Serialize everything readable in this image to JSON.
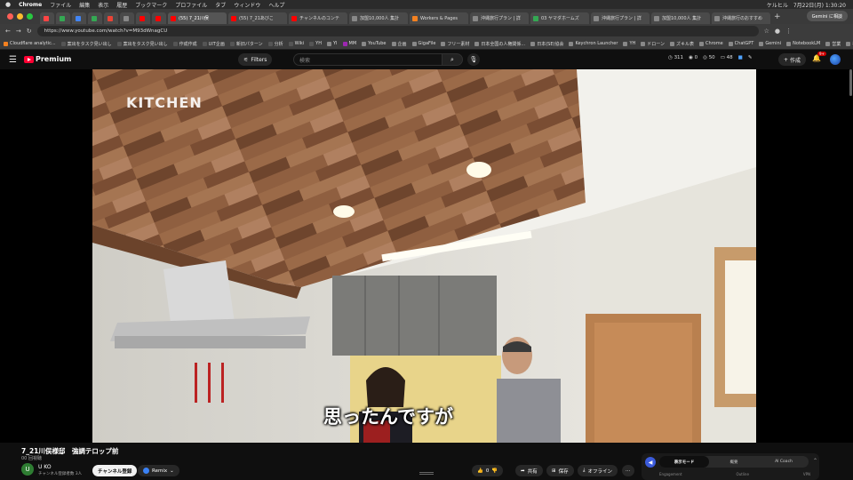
{
  "menubar": {
    "app": "Chrome",
    "items": [
      "ファイル",
      "編集",
      "表示",
      "履歴",
      "ブックマーク",
      "プロファイル",
      "タブ",
      "ウィンドウ",
      "ヘルプ"
    ],
    "right": {
      "user": "ケルヒル",
      "datetime": "7月22日(月) 1:30:20"
    }
  },
  "tabs": [
    {
      "kind": "mini",
      "color": "#ff4444"
    },
    {
      "kind": "mini",
      "color": "#34a853"
    },
    {
      "kind": "mini",
      "color": "#4285f4"
    },
    {
      "kind": "mini",
      "color": "#34a853"
    },
    {
      "kind": "mini",
      "color": "#ea4335"
    },
    {
      "kind": "mini",
      "color": "#888888"
    },
    {
      "kind": "mini",
      "color": "#ff0000"
    },
    {
      "kind": "mini",
      "color": "#ff0000"
    },
    {
      "kind": "wide",
      "label": "(55) 7_21川俣",
      "color": "#ff0000",
      "active": true
    },
    {
      "kind": "wide",
      "label": "(55) 7_21あびこ",
      "color": "#ff0000"
    },
    {
      "kind": "wide",
      "label": "チャンネルのコンテ",
      "color": "#ff0000"
    },
    {
      "kind": "wide",
      "label": "加盟10,000人 集計",
      "color": "#888888"
    },
    {
      "kind": "wide",
      "label": "Workers & Pages",
      "color": "#f48120"
    },
    {
      "kind": "wide",
      "label": "沖縄旅行プラン | 詳",
      "color": "#888888"
    },
    {
      "kind": "wide",
      "label": "03 ヤマダホームズ",
      "color": "#34a853"
    },
    {
      "kind": "wide",
      "label": "沖縄旅行プラン | 詳",
      "color": "#888888"
    },
    {
      "kind": "wide",
      "label": "加盟10,000人 集計",
      "color": "#888888"
    },
    {
      "kind": "wide",
      "label": "沖縄旅行のおすすめ",
      "color": "#888888"
    }
  ],
  "gemini_label": "Gemini に相談",
  "url": "https://www.youtube.com/watch?v=M93dWnagCU",
  "bookmarks": [
    {
      "label": "Cloudflare analytic...",
      "color": "#f48120"
    },
    {
      "label": "案出をタスク見い出し",
      "color": "#555555"
    },
    {
      "label": "案出をタスク見い出し",
      "color": "#555555"
    },
    {
      "label": "作成作成",
      "color": "#555555"
    },
    {
      "label": "UIT企画",
      "color": "#555555"
    },
    {
      "label": "新旧パターン",
      "color": "#555555"
    },
    {
      "label": "分析",
      "color": "#555555"
    },
    {
      "label": "Wiki",
      "color": "#555555"
    },
    {
      "label": "YH",
      "color": "#555555"
    },
    {
      "label": "YI",
      "color": "#888888"
    },
    {
      "label": "MM",
      "color": "#9c27b0"
    },
    {
      "label": "YouTube",
      "color": "#888888"
    },
    {
      "label": "企画",
      "color": "#888888"
    },
    {
      "label": "GigaFile",
      "color": "#888888"
    },
    {
      "label": "フリー素材",
      "color": "#888888"
    },
    {
      "label": "日本全国の人権関係...",
      "color": "#888888"
    },
    {
      "label": "日本(SE)協会",
      "color": "#888888"
    },
    {
      "label": "Keychron Launcher",
      "color": "#888888"
    },
    {
      "label": "YH",
      "color": "#888888"
    },
    {
      "label": "ドローン",
      "color": "#888888"
    },
    {
      "label": "ズキル表",
      "color": "#888888"
    },
    {
      "label": "Chrome",
      "color": "#888888"
    },
    {
      "label": "ChatGPT",
      "color": "#888888"
    },
    {
      "label": "Gemini",
      "color": "#888888"
    },
    {
      "label": "NotebookLM",
      "color": "#888888"
    },
    {
      "label": "営業",
      "color": "#888888"
    },
    {
      "label": "補助金",
      "color": "#888888"
    },
    {
      "label": "便利サイト",
      "color": "#888888"
    }
  ],
  "yt": {
    "brand": "Premium",
    "filters": "Filters",
    "search_placeholder": "検索",
    "stats": [
      "311",
      "0",
      "50",
      "48"
    ],
    "create": "作成",
    "notif": "9+"
  },
  "video": {
    "overlay": "KITCHEN",
    "caption": "思ったんですが"
  },
  "info": {
    "title": "7_21川俣様邸　強調テロップ前",
    "views": "00 回視聴",
    "channel": "U KO",
    "subs": "チャンネル登録者数 3人",
    "subscribe": "チャンネル登録",
    "remix": "Remix",
    "likes": "0",
    "share": "共有",
    "save": "保存",
    "offline": "オフライン"
  },
  "sidepanel": {
    "segments": [
      "表示モード",
      "概要",
      "AI Coach"
    ],
    "active": 0,
    "labels": [
      "Engagement",
      "Outline",
      "VPN"
    ]
  },
  "colors": {
    "accent": "#ff0033",
    "bg": "#0f0f0f"
  }
}
